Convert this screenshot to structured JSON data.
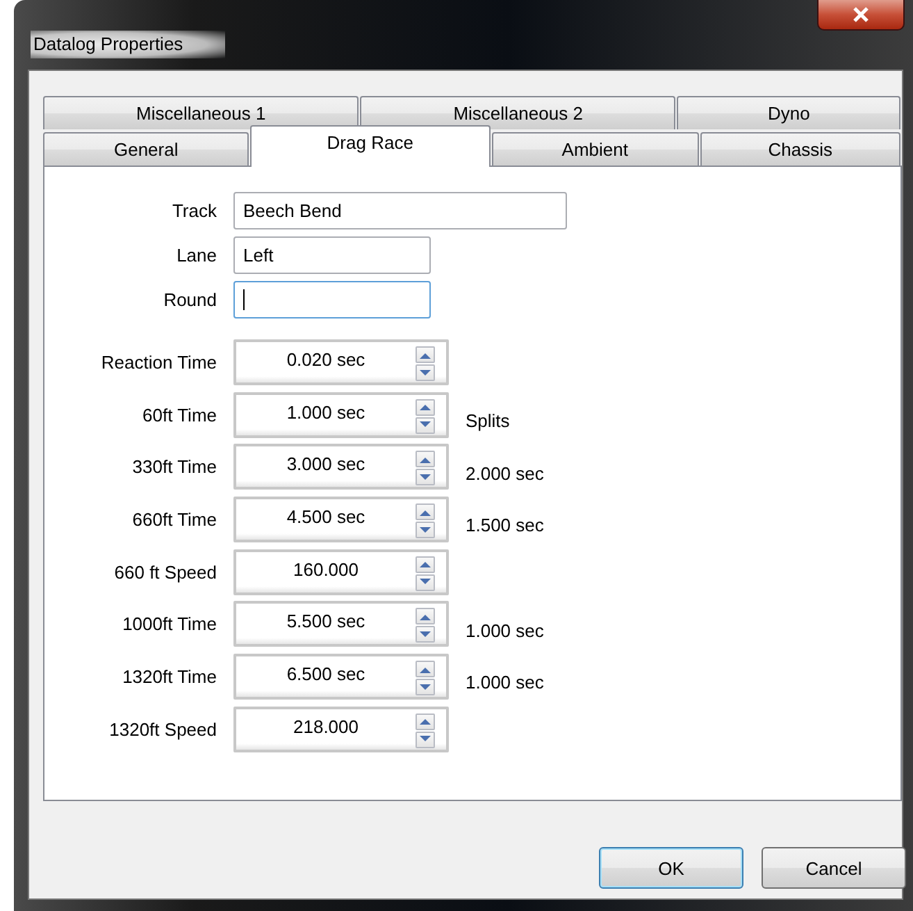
{
  "window": {
    "title": "Datalog Properties"
  },
  "tab_rows": [
    {
      "tabs": [
        {
          "label": "Miscellaneous 1",
          "selected": false
        },
        {
          "label": "Miscellaneous 2",
          "selected": false
        },
        {
          "label": "Dyno",
          "selected": false
        }
      ]
    },
    {
      "tabs": [
        {
          "label": "General",
          "selected": false
        },
        {
          "label": "Drag Race",
          "selected": true
        },
        {
          "label": "Ambient",
          "selected": false
        },
        {
          "label": "Chassis",
          "selected": false
        }
      ]
    }
  ],
  "text_fields": [
    {
      "label": "Track",
      "value": "Beech Bend",
      "focused": false
    },
    {
      "label": "Lane",
      "value": "Left",
      "focused": false
    },
    {
      "label": "Round",
      "focused": true
    }
  ],
  "spin_fields": [
    {
      "label": "Reaction Time",
      "value": "0.020 sec"
    },
    {
      "label": "60ft Time",
      "value": "1.000 sec",
      "note": "Splits"
    },
    {
      "label": "330ft Time",
      "value": "3.000 sec",
      "note": "2.000 sec"
    },
    {
      "label": "660ft Time",
      "value": "4.500 sec",
      "note": "1.500 sec"
    },
    {
      "label": "660 ft Speed",
      "value": "160.000"
    },
    {
      "label": "1000ft Time",
      "value": "5.500 sec",
      "note": "1.000 sec"
    },
    {
      "label": "1320ft Time",
      "value": "6.500 sec",
      "note": "1.000 sec"
    },
    {
      "label": "1320ft Speed",
      "value": "218.000"
    }
  ],
  "buttons": [
    {
      "label": "OK",
      "default": true
    },
    {
      "label": "Cancel",
      "default": false
    }
  ]
}
